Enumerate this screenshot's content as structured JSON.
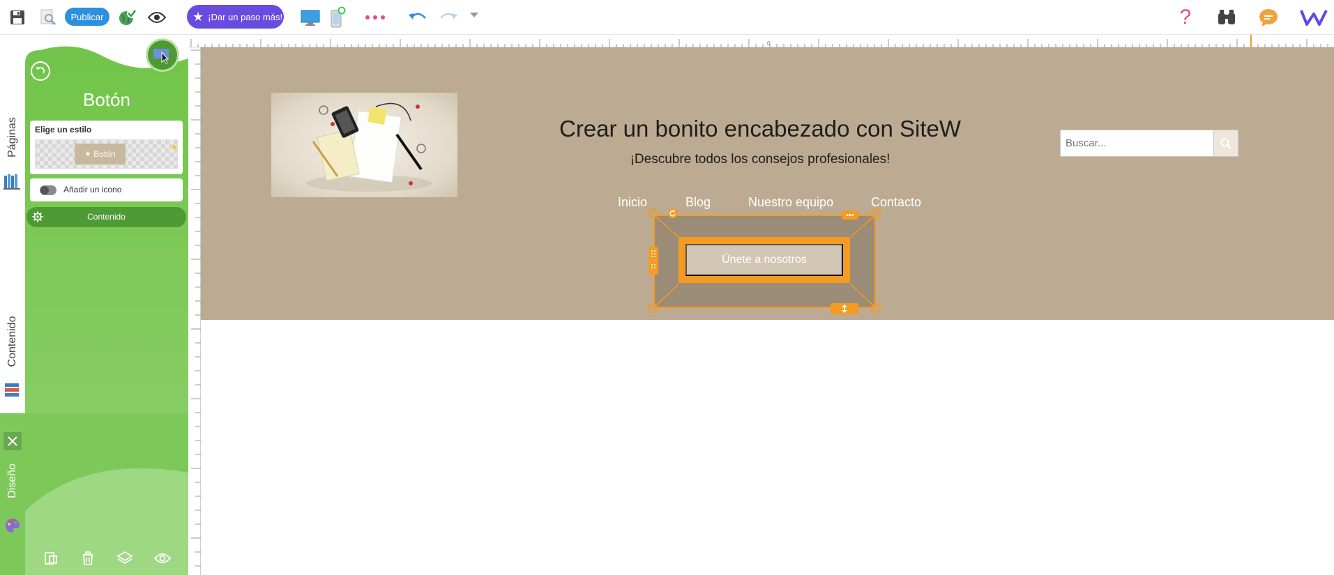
{
  "toolbar": {
    "publish_label": "Publicar",
    "upgrade_label": "¡Dar un paso más!"
  },
  "tabs": {
    "pages_label": "Páginas",
    "content_label": "Contenido",
    "design_label": "Diseño"
  },
  "panel": {
    "title": "Botón",
    "style_card_title": "Elige un estilo",
    "style_sample_label": "Botón",
    "add_icon_label": "Añadir un icono",
    "content_row_label": "Contenido"
  },
  "page": {
    "title": "Crear un bonito encabezado con SiteW",
    "subtitle": "¡Descubre todos los consejos profesionales!",
    "search_placeholder": "Buscar...",
    "nav": [
      "Inicio",
      "Blog",
      "Nuestro equipo",
      "Contacto"
    ],
    "cta_label": "Únete a nosotros",
    "background_color": "#bcab92"
  },
  "colors": {
    "accent_green": "#7cc95a",
    "dark_green": "#4e9a34",
    "publish_blue": "#2d8fe0",
    "upgrade_purple": "#6a4be0",
    "selection_orange": "#f59a22"
  },
  "icons": {
    "save": "save-icon",
    "preview_page": "page-preview-icon",
    "seo": "globe-check-icon",
    "view": "eye-icon",
    "desktop": "desktop-icon",
    "mobile": "mobile-icon",
    "more": "more-dots-icon",
    "undo": "undo-icon",
    "redo": "redo-icon",
    "help": "question-icon",
    "search_site": "binoculars-icon",
    "chat": "chat-icon",
    "logo": "sitew-logo-icon"
  }
}
